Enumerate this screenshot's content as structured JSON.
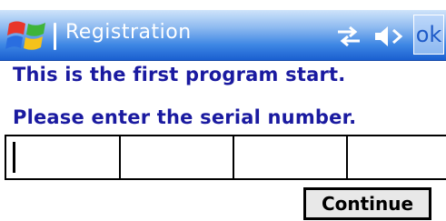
{
  "titlebar": {
    "start_icon": "windows-flag-icon",
    "title": "Registration",
    "connectivity_icon": "connectivity-arrows-icon",
    "volume_icon": "volume-speaker-icon",
    "ok_label": "ok",
    "background_color": "#3d86e4"
  },
  "content": {
    "message_line1": "This is the first program start.",
    "message_line2": "Please enter the serial number.",
    "text_color": "#1a1aa0"
  },
  "serial": {
    "field_count": 4,
    "fields": [
      {
        "value": ""
      },
      {
        "value": ""
      },
      {
        "value": ""
      },
      {
        "value": ""
      }
    ]
  },
  "actions": {
    "continue_label": "Continue"
  }
}
